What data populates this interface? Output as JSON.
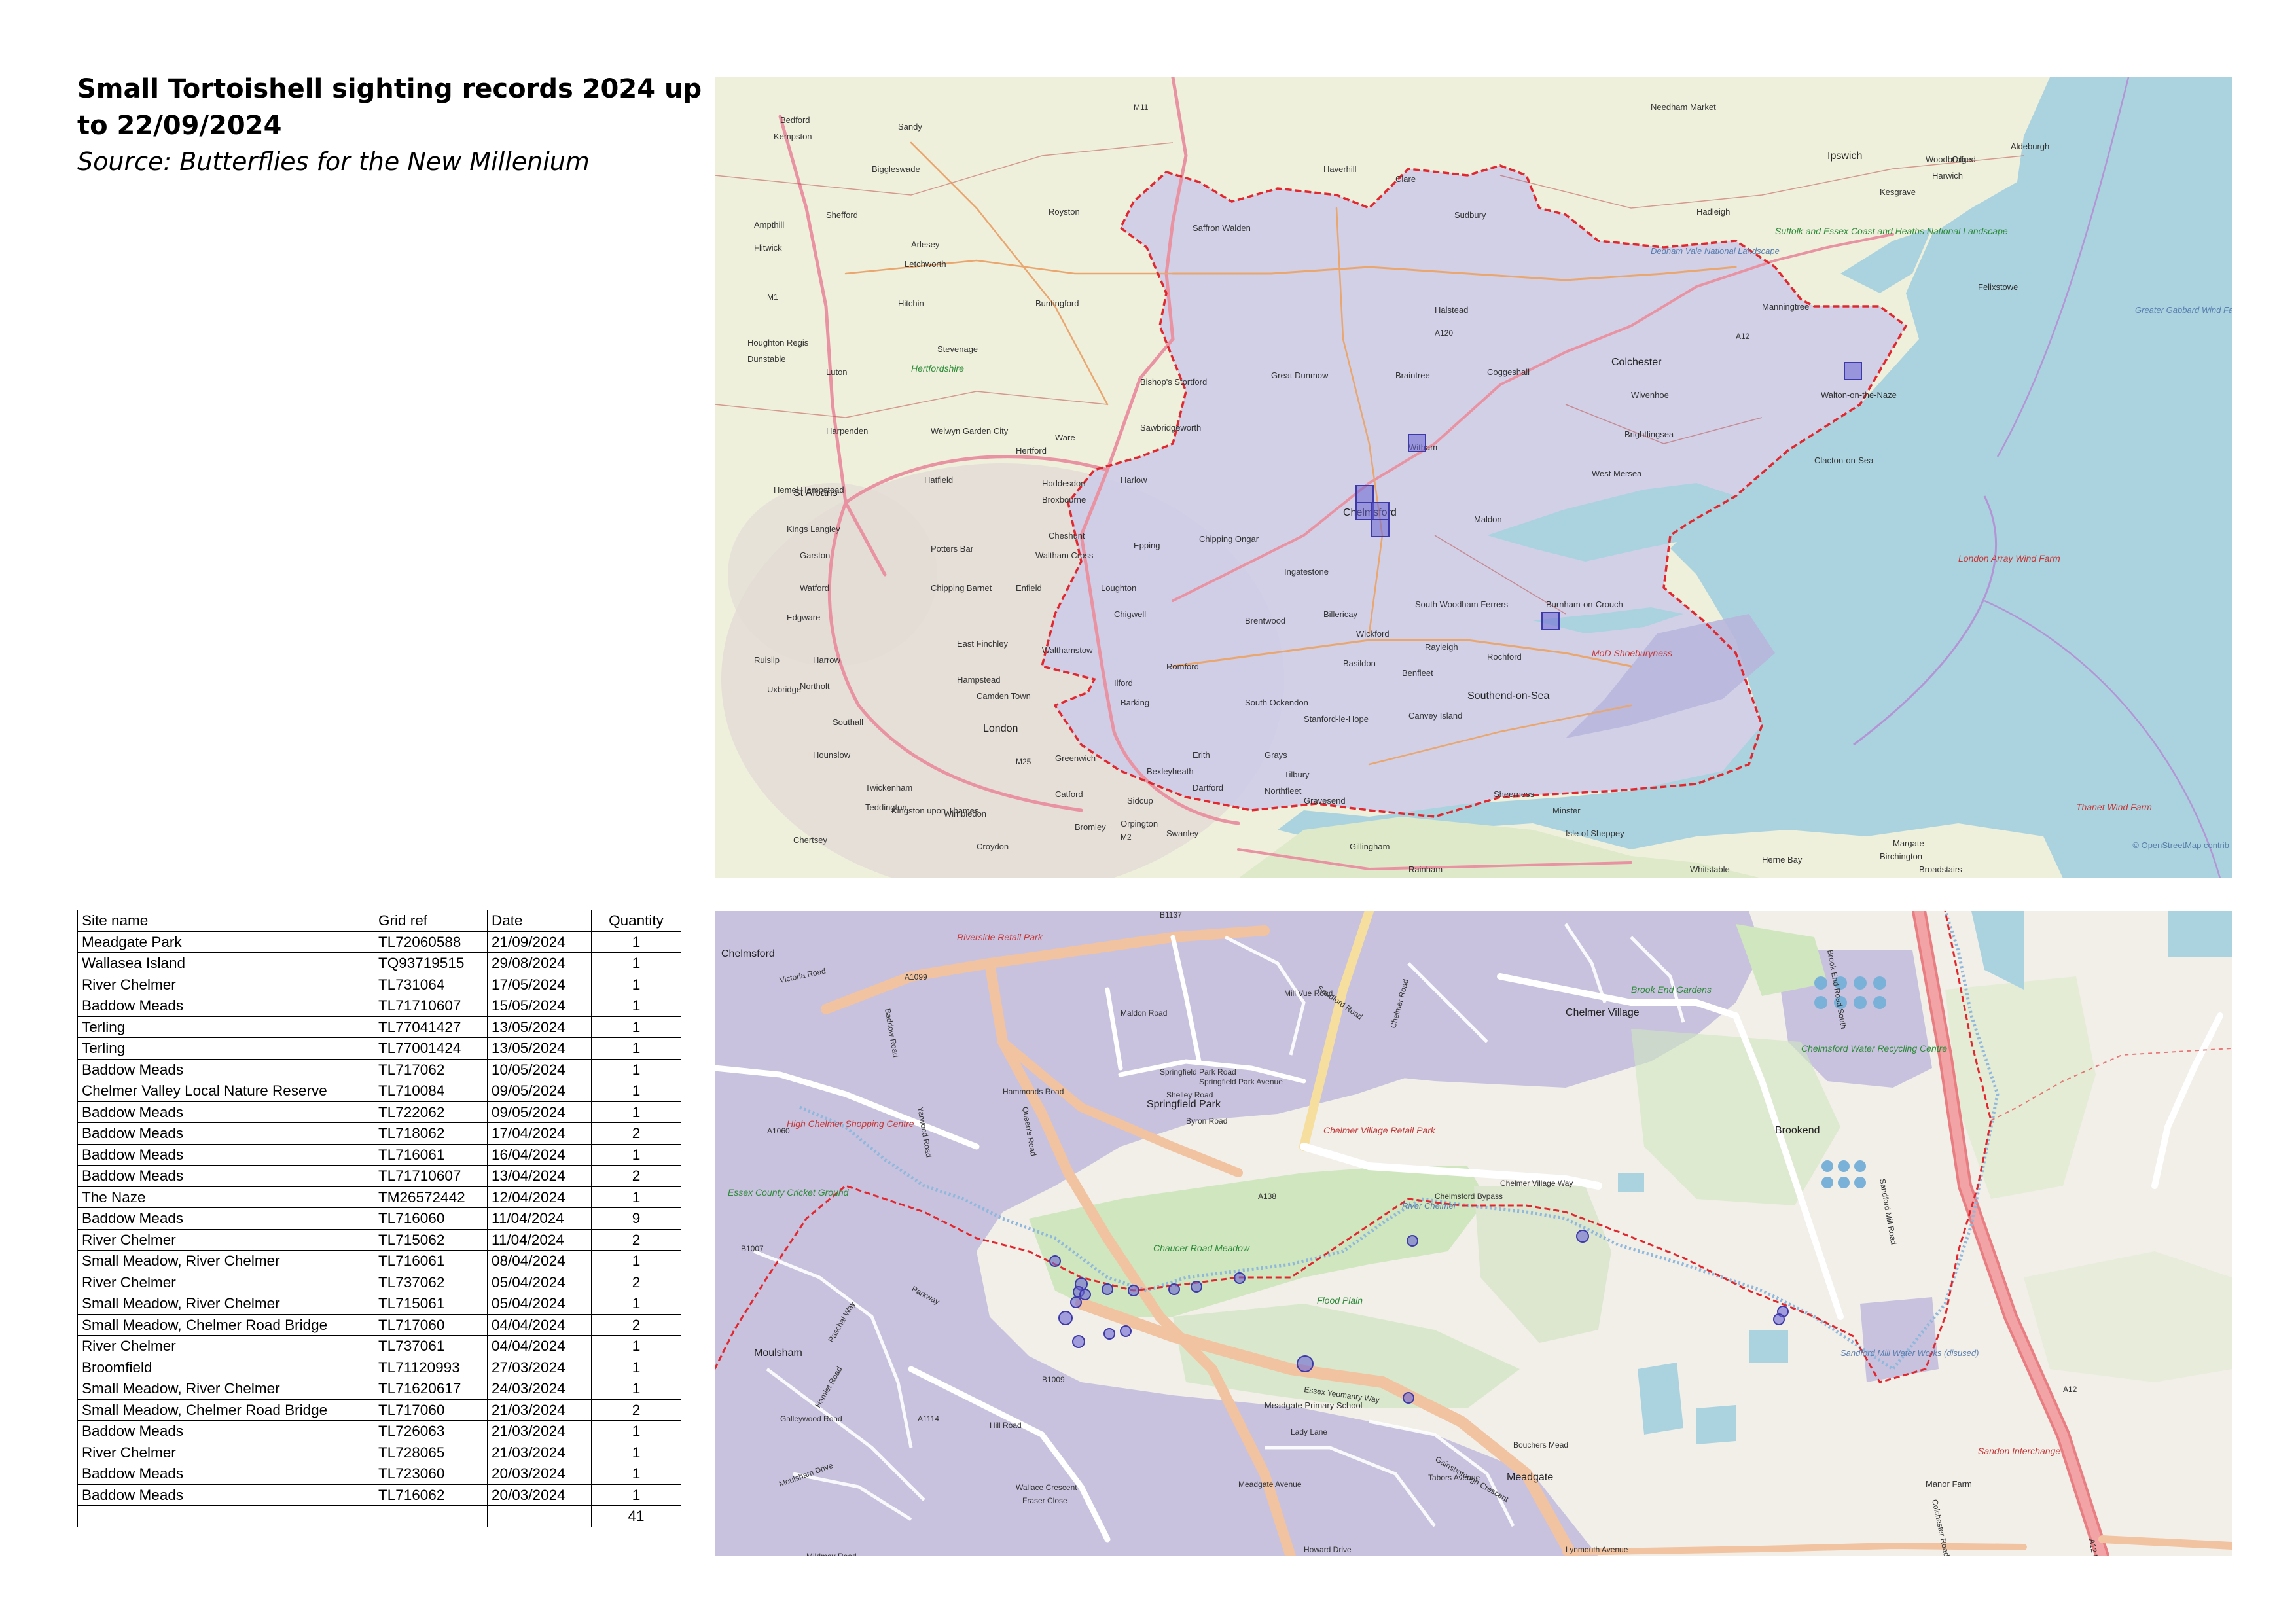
{
  "title": "Small Tortoishell sighting records 2024 up to 22/09/2024",
  "source": "Source: Butterflies for the New Millenium",
  "overview_map": {
    "attribution": "© OpenStreetMap contrib",
    "places": [
      "Bedford",
      "Kempston",
      "Sandy",
      "Biggleswade",
      "Shefford",
      "Ampthill",
      "Flitwick",
      "Arlesey",
      "Letchworth",
      "Hitchin",
      "Royston",
      "Buntingford",
      "Stevenage",
      "Luton",
      "Houghton Regis",
      "Dunstable",
      "Harpenden",
      "St Albans",
      "Welwyn Garden City",
      "Ware",
      "Hertford",
      "Hatfield",
      "Hemel Hempstead",
      "Kings Langley",
      "Garston",
      "Watford",
      "Potters Bar",
      "Cheshunt",
      "Waltham Cross",
      "Chipping Barnet",
      "Enfield",
      "Harrow",
      "Edgware",
      "East Finchley",
      "Hampstead",
      "Camden Town",
      "Ruislip",
      "Northolt",
      "Southall",
      "Uxbridge",
      "London",
      "Hounslow",
      "Twickenham",
      "Teddington",
      "Kingston upon Thames",
      "Chertsey",
      "Wimbledon",
      "Croydon",
      "Catford",
      "Greenwich",
      "Bexleyheath",
      "Sidcup",
      "Orpington",
      "Bromley",
      "Swanley",
      "Dartford",
      "Gravesend",
      "Northfleet",
      "Tilbury",
      "Erith",
      "Grays",
      "Barking",
      "Ilford",
      "Romford",
      "Walthamstow",
      "Chigwell",
      "Loughton",
      "Epping",
      "Harlow",
      "Hoddesdon",
      "Broxbourne",
      "Sawbridgeworth",
      "Bishop's Stortford",
      "Saffron Walden",
      "Haverhill",
      "Clare",
      "Sudbury",
      "Halstead",
      "Braintree",
      "Great Dunmow",
      "Coggeshall",
      "Witham",
      "Colchester",
      "Wivenhoe",
      "Brightlingsea",
      "West Mersea",
      "Clacton-on-Sea",
      "Walton-on-the-Naze",
      "Harwich",
      "Felixstowe",
      "Manningtree",
      "Hadleigh",
      "Kesgrave",
      "Ipswich",
      "Woodbridge",
      "Orford",
      "Aldeburgh",
      "Needham Market",
      "Chelmsford",
      "Maldon",
      "Chipping Ongar",
      "Ingatestone",
      "Brentwood",
      "Billericay",
      "Wickford",
      "South Woodham Ferrers",
      "Burnham-on-Crouch",
      "Rayleigh",
      "Rochford",
      "Basildon",
      "Benfleet",
      "Canvey Island",
      "Southend-on-Sea",
      "Stanford-le-Hope",
      "South Ockendon",
      "Sheerness",
      "Minster",
      "Isle of Sheppey",
      "Gillingham",
      "Rainham",
      "Herne Bay",
      "Birchington",
      "Margate",
      "Broadstairs",
      "Whitstable"
    ],
    "special_labels": [
      "Suffolk and Essex Coast and Heaths National Landscape",
      "Dedham Vale National Landscape",
      "MoD Shoeburyness",
      "London Array Wind Farm",
      "Thanet Wind Farm",
      "Hertfordshire",
      "Greater Gabbard Wind Farm"
    ],
    "roads": [
      "M11",
      "M1",
      "M2",
      "A12",
      "A120",
      "M25"
    ]
  },
  "detail_map": {
    "places": [
      "Chelmsford",
      "Chelmer Village",
      "Springfield Park",
      "Brookend",
      "Moulsham",
      "Meadgate",
      "Sandon Interchange",
      "Manor Farm"
    ],
    "special_labels": [
      "Riverside Retail Park",
      "High Chelmer Shopping Centre",
      "Essex County Cricket Ground",
      "Chelmer Village Retail Park",
      "Chaucer Road Meadow",
      "Flood Plain",
      "Brook End Gardens",
      "Chelmsford Water Recycling Centre",
      "Sandford Mill Water Works (disused)",
      "Meadgate Primary School",
      "River Chelmer"
    ],
    "roads": [
      "Victoria Road",
      "Parkway",
      "Essex Yeomanry Way",
      "Chelmer Road",
      "Chelmer Village Way",
      "Springfield Park Road",
      "Springfield Park Avenue",
      "Shelley Road",
      "Byron Road",
      "Baddow Road",
      "Maldon Road",
      "Hammonds Road",
      "Sandford Road",
      "Sandford Mill Road",
      "Brook End Road South",
      "Meadgate Avenue",
      "Wallace Crescent",
      "Fraser Close",
      "Moulsham Drive",
      "Bouchers Mead",
      "Howard Drive",
      "Colchester Road",
      "A12 Bypass",
      "Chelmsford Bypass",
      "Mill Vue Road",
      "Yarwood Road",
      "Queen's Road",
      "Hill Road",
      "Lady Lane",
      "Gainsborough Crescent",
      "Tabors Avenue",
      "Paschal Way",
      "Galleywood Road",
      "Hamlet Road",
      "Lynmouth Avenue",
      "Mildmay Road",
      "Princes Road"
    ],
    "road_refs": [
      "A1099",
      "A1060",
      "A138",
      "A1114",
      "B1009",
      "B1007",
      "B1137",
      "A12"
    ]
  },
  "table": {
    "headers": [
      "Site name",
      "Grid ref",
      "Date",
      "Quantity"
    ],
    "rows": [
      [
        "Meadgate Park",
        "TL72060588",
        "21/09/2024",
        "1"
      ],
      [
        "Wallasea Island",
        "TQ93719515",
        "29/08/2024",
        "1"
      ],
      [
        "River Chelmer",
        "TL731064",
        "17/05/2024",
        "1"
      ],
      [
        "Baddow Meads",
        "TL71710607",
        "15/05/2024",
        "1"
      ],
      [
        "Terling",
        "TL77041427",
        "13/05/2024",
        "1"
      ],
      [
        "Terling",
        "TL77001424",
        "13/05/2024",
        "1"
      ],
      [
        "Baddow Meads",
        "TL717062",
        "10/05/2024",
        "1"
      ],
      [
        "Chelmer Valley Local Nature Reserve",
        "TL710084",
        "09/05/2024",
        "1"
      ],
      [
        "Baddow Meads",
        "TL722062",
        "09/05/2024",
        "1"
      ],
      [
        "Baddow Meads",
        "TL718062",
        "17/04/2024",
        "2"
      ],
      [
        "Baddow Meads",
        "TL716061",
        "16/04/2024",
        "1"
      ],
      [
        "Baddow Meads",
        "TL71710607",
        "13/04/2024",
        "2"
      ],
      [
        "The Naze",
        "TM26572442",
        "12/04/2024",
        "1"
      ],
      [
        "Baddow Meads",
        "TL716060",
        "11/04/2024",
        "9"
      ],
      [
        "River Chelmer",
        "TL715062",
        "11/04/2024",
        "2"
      ],
      [
        "Small Meadow, River Chelmer",
        "TL716061",
        "08/04/2024",
        "1"
      ],
      [
        "River Chelmer",
        "TL737062",
        "05/04/2024",
        "2"
      ],
      [
        "Small Meadow, River Chelmer",
        "TL715061",
        "05/04/2024",
        "1"
      ],
      [
        "Small Meadow, Chelmer Road Bridge",
        "TL717060",
        "04/04/2024",
        "2"
      ],
      [
        "River Chelmer",
        "TL737061",
        "04/04/2024",
        "1"
      ],
      [
        "Broomfield",
        "TL71120993",
        "27/03/2024",
        "1"
      ],
      [
        "Small Meadow, River Chelmer",
        "TL71620617",
        "24/03/2024",
        "1"
      ],
      [
        "Small Meadow, Chelmer Road Bridge",
        "TL717060",
        "21/03/2024",
        "2"
      ],
      [
        "Baddow Meads",
        "TL726063",
        "21/03/2024",
        "1"
      ],
      [
        "River Chelmer",
        "TL728065",
        "21/03/2024",
        "1"
      ],
      [
        "Baddow Meads",
        "TL723060",
        "20/03/2024",
        "1"
      ],
      [
        "Baddow Meads",
        "TL716062",
        "20/03/2024",
        "1"
      ]
    ],
    "total": "41"
  },
  "colors": {
    "essex_fill": "#c9c7e6",
    "boundary": "#e0282e",
    "sea": "#aad3df",
    "marker": "#5a55c8",
    "land": "#f2efe9"
  }
}
